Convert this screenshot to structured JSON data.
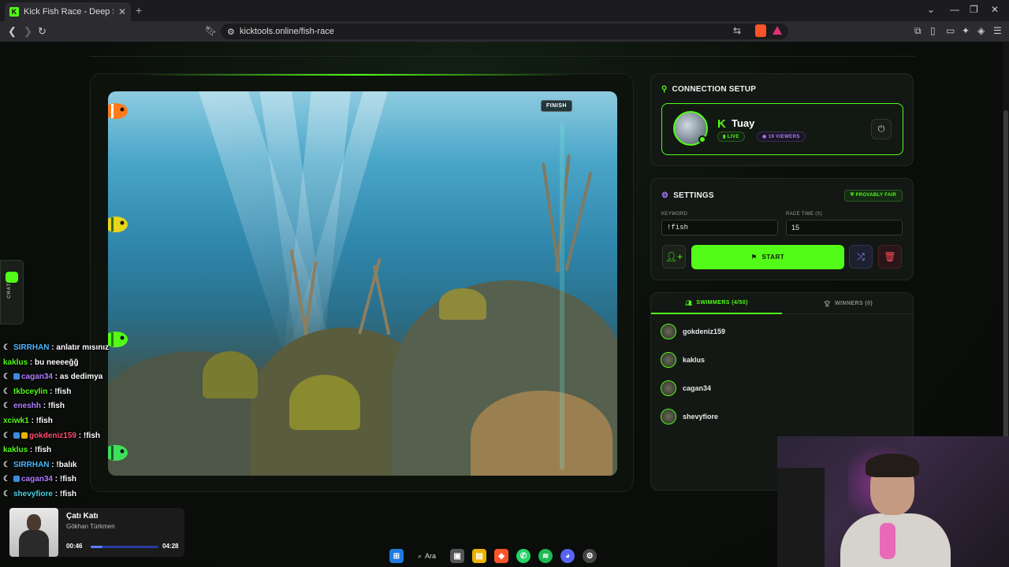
{
  "browser": {
    "tab_title": "Kick Fish Race - Deep Sea Showdown",
    "tab_favicon": "K",
    "new_tab": "+",
    "url": "kicktools.online/fish-race"
  },
  "race": {
    "finish_label": "FINISH"
  },
  "connection": {
    "title": "CONNECTION SETUP",
    "kick_logo": "K",
    "username": "Tuay",
    "live_label": "LIVE",
    "viewers_label": "19 VIEWERS",
    "viewers_count": 19
  },
  "settings": {
    "title": "SETTINGS",
    "provably_fair": "PROVABLY FAIR",
    "keyword_label": "KEYWORD",
    "keyword_value": "!fish",
    "race_time_label": "RACE TIME (S)",
    "race_time_value": "15",
    "start_label": "START"
  },
  "lists": {
    "swimmers_tab": "SWIMMERS (4/50)",
    "winners_tab": "WINNERS (0)",
    "swimmers": [
      "gokdeniz159",
      "kaklus",
      "cagan34",
      "shevyfiore"
    ]
  },
  "chat_widget": {
    "label": "CHAT"
  },
  "chat": [
    {
      "user": "SIRRHAN",
      "msg": " : anlatır mısınız",
      "color": "#4db8ff",
      "moon": true,
      "badges": []
    },
    {
      "user": "kaklus",
      "msg": " : bu neeeeğğ",
      "color": "#53fc18",
      "moon": false,
      "badges": []
    },
    {
      "user": "cagan34",
      "msg": " : as dedimya",
      "color": "#b07cff",
      "moon": true,
      "badges": [
        "#3a8dde"
      ]
    },
    {
      "user": "tkbceylin",
      "msg": " : !fish",
      "color": "#53fc18",
      "moon": true,
      "badges": []
    },
    {
      "user": "eneshh",
      "msg": " : !fish",
      "color": "#b07cff",
      "moon": true,
      "badges": []
    },
    {
      "user": "xciwk1",
      "msg": " : !fish",
      "color": "#53fc18",
      "moon": false,
      "badges": []
    },
    {
      "user": "gokdeniz159",
      "msg": " : !fish",
      "color": "#ff4d6d",
      "moon": true,
      "badges": [
        "#3a8dde",
        "#e8b400"
      ]
    },
    {
      "user": "kaklus",
      "msg": " : !fish",
      "color": "#53fc18",
      "moon": false,
      "badges": []
    },
    {
      "user": "SIRRHAN",
      "msg": " : !balık",
      "color": "#4db8ff",
      "moon": true,
      "badges": []
    },
    {
      "user": "cagan34",
      "msg": " : !fish",
      "color": "#b07cff",
      "moon": true,
      "badges": [
        "#3a8dde"
      ]
    },
    {
      "user": "shevyfiore",
      "msg": " : !fish",
      "color": "#4dd0e1",
      "moon": true,
      "badges": []
    }
  ],
  "music": {
    "song": "Çatı Katı",
    "artist": "Gökhan Türkmen",
    "time_current": "00:46",
    "time_total": "04:28",
    "progress": 0.17
  },
  "taskbar": {
    "search_label": "Ara"
  },
  "colors": {
    "accent": "#53fc18",
    "purple": "#b07cff",
    "panel_bg": "#141814",
    "page_bg": "#0b0d0b"
  }
}
